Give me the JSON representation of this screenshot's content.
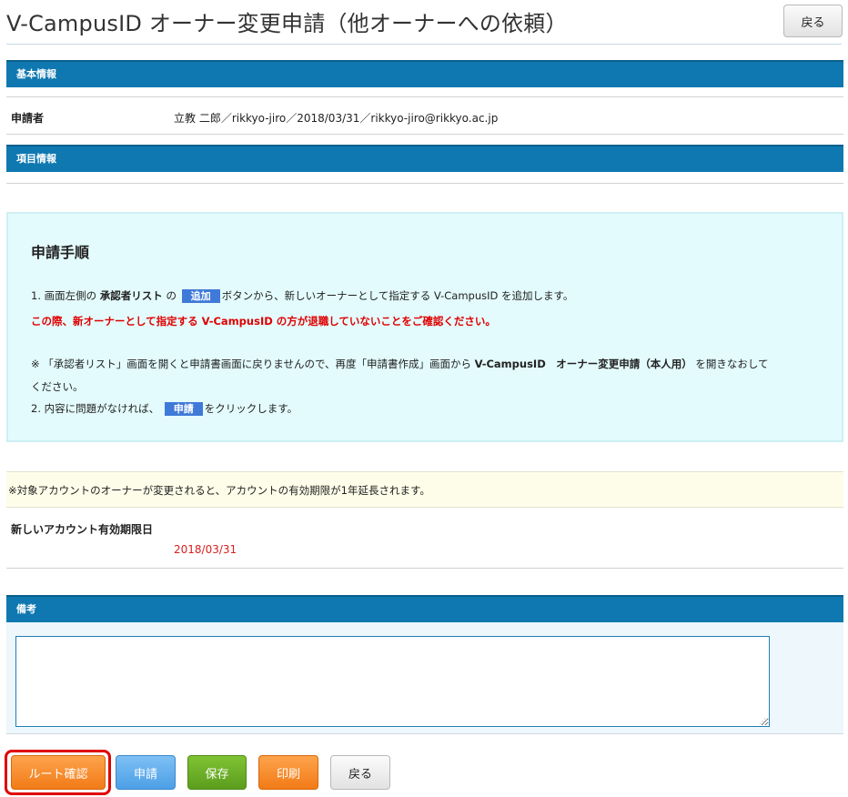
{
  "header": {
    "title": "V-CampusID オーナー変更申請（他オーナーへの依頼）",
    "back_label": "戻る"
  },
  "basic_info": {
    "section_title": "基本情報",
    "applicant_label": "申請者",
    "applicant_value": "立教 二郎／rikkyo-jiro／2018/03/31／rikkyo-jiro@rikkyo.ac.jp"
  },
  "item_info": {
    "section_title": "項目情報"
  },
  "procedure": {
    "title": "申請手順",
    "step1_prefix": "1. 画面左側の",
    "step1_list": "承認者リスト",
    "step1_no": "の",
    "step1_add_button": "追加",
    "step1_suffix": "ボタンから、新しいオーナーとして指定する V-CampusID を追加します。",
    "warning": "この際、新オーナーとして指定する V-CampusID の方が退職していないことをご確認ください。",
    "note_prefix": "※ 「承認者リスト」画面を開くと申請書画面に戻りませんので、再度「申請書作成」画面から",
    "note_bold": "V-CampusID　オーナー変更申請（本人用）",
    "note_suffix": "を開きなおして",
    "note_line2": "ください。",
    "step2_prefix": "2. 内容に問題がなければ、",
    "step2_apply_button": "申請",
    "step2_suffix": "をクリックします。"
  },
  "notice": {
    "text": "※対象アカウントのオーナーが変更されると、アカウントの有効期限が1年延長されます。"
  },
  "new_expiry": {
    "label": "新しいアカウント有効期限日",
    "value": "2018/03/31"
  },
  "remarks": {
    "section_title": "備考",
    "value": ""
  },
  "footer_buttons": {
    "route_check": "ルート確認",
    "apply": "申請",
    "save": "保存",
    "print": "印刷",
    "back": "戻る"
  },
  "colors": {
    "section_bar": "#0f78b0",
    "procedure_bg": "#e3fbfc",
    "warning_text": "#e00000",
    "highlight": "#e00000",
    "orange_button": "#f5861f",
    "blue_button": "#4c9fe6",
    "green_button": "#6aab27"
  }
}
